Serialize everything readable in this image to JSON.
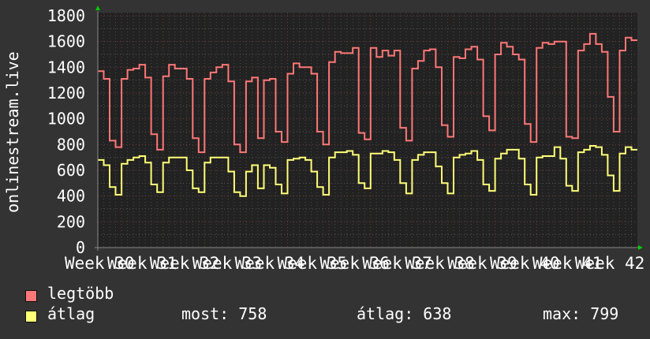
{
  "chart_data": {
    "type": "line",
    "ylabel": "onlinestream.live",
    "ylim": [
      0,
      1800
    ],
    "yticks": [
      0,
      200,
      400,
      600,
      800,
      1000,
      1200,
      1400,
      1600,
      1800
    ],
    "xtick_labels": [
      "Week 30",
      "Week 31",
      "Week 32",
      "Week 33",
      "Week 34",
      "Week 35",
      "Week 36",
      "Week 37",
      "Week 38",
      "Week 39",
      "Week 40",
      "Week 41",
      "Week 42"
    ],
    "x_unit": "day",
    "grid": true,
    "series": [
      {
        "name": "legtöbb",
        "color": "#ff7777",
        "values": [
          1370,
          1310,
          830,
          780,
          1310,
          1380,
          1390,
          1420,
          1320,
          880,
          760,
          1330,
          1420,
          1390,
          1390,
          1310,
          850,
          740,
          1310,
          1360,
          1400,
          1420,
          1290,
          800,
          740,
          1290,
          1320,
          850,
          1300,
          1310,
          900,
          820,
          1350,
          1430,
          1400,
          1400,
          1350,
          900,
          800,
          1440,
          1520,
          1510,
          1510,
          1550,
          890,
          840,
          1550,
          1480,
          1530,
          1490,
          1530,
          930,
          830,
          1390,
          1450,
          1530,
          1540,
          1400,
          950,
          860,
          1480,
          1470,
          1540,
          1560,
          1460,
          1020,
          910,
          1500,
          1590,
          1560,
          1500,
          1460,
          960,
          820,
          1550,
          1590,
          1580,
          1600,
          1600,
          860,
          850,
          1530,
          1580,
          1660,
          1580,
          1520,
          1170,
          900,
          1530,
          1630,
          1610
        ]
      },
      {
        "name": "átlag",
        "color": "#ffff77",
        "values": [
          680,
          640,
          470,
          410,
          650,
          680,
          700,
          710,
          660,
          490,
          430,
          660,
          700,
          700,
          700,
          600,
          460,
          430,
          660,
          700,
          700,
          700,
          590,
          430,
          400,
          590,
          640,
          460,
          640,
          620,
          490,
          420,
          680,
          690,
          700,
          680,
          590,
          470,
          410,
          700,
          740,
          740,
          750,
          720,
          500,
          460,
          730,
          730,
          750,
          740,
          680,
          500,
          420,
          680,
          720,
          740,
          740,
          630,
          500,
          420,
          700,
          720,
          730,
          750,
          680,
          490,
          440,
          690,
          730,
          760,
          760,
          690,
          490,
          410,
          700,
          710,
          710,
          780,
          690,
          480,
          440,
          740,
          760,
          790,
          780,
          720,
          560,
          440,
          730,
          780,
          760
        ]
      }
    ],
    "legend": {
      "placement": "bottom-left",
      "max_label": "legtöbb",
      "avg_label": "átlag",
      "stats": {
        "now": "most: 758",
        "avg": "átlag: 638",
        "max": "max: 799"
      }
    }
  }
}
